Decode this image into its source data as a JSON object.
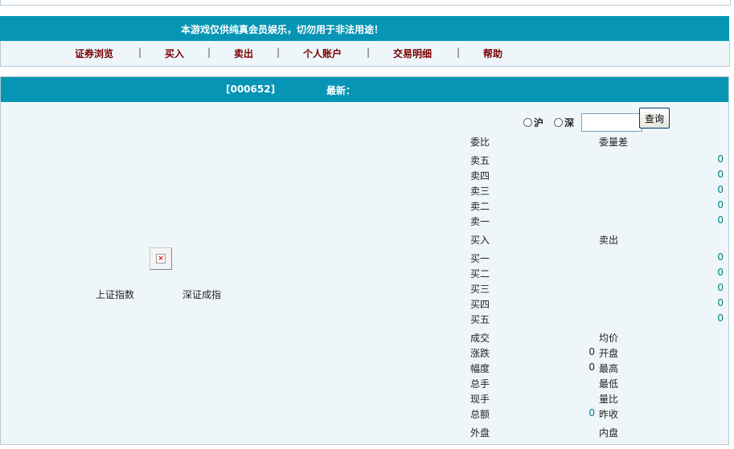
{
  "banner": {
    "notice": "本游戏仅供纯真会员娱乐，切勿用于非法用途！"
  },
  "nav": {
    "items": [
      "证券浏览",
      "买入",
      "卖出",
      "个人账户",
      "交易明细",
      "帮助"
    ],
    "separator": "|"
  },
  "header": {
    "code": "[000652]",
    "latest_label": "最新："
  },
  "indices": {
    "sh": "上证指数",
    "sz": "深证成指"
  },
  "exchange": {
    "sh": "沪",
    "sz": "深",
    "query_button": "查询",
    "search_value": ""
  },
  "order_book": {
    "ratio_label": "委比",
    "diff_label": "委量差",
    "sell_rows": [
      {
        "label": "卖五",
        "value": "0"
      },
      {
        "label": "卖四",
        "value": "0"
      },
      {
        "label": "卖三",
        "value": "0"
      },
      {
        "label": "卖二",
        "value": "0"
      },
      {
        "label": "卖一",
        "value": "0"
      }
    ],
    "buy_label": "买入",
    "sell_label": "卖出",
    "buy_rows": [
      {
        "label": "买一",
        "value": "0"
      },
      {
        "label": "买二",
        "value": "0"
      },
      {
        "label": "买三",
        "value": "0"
      },
      {
        "label": "买四",
        "value": "0"
      },
      {
        "label": "买五",
        "value": "0"
      }
    ]
  },
  "stats": {
    "deal": "成交",
    "avg_price": "均价",
    "change": "涨跌",
    "change_value": "0",
    "open": "开盘",
    "amplitude": "幅度",
    "amplitude_value": "0",
    "high": "最高",
    "total_volume": "总手",
    "low": "最低",
    "current_volume": "现手",
    "volume_ratio": "量比",
    "total_amount": "总额",
    "total_amount_value": "0",
    "prev_close": "昨收",
    "outer": "外盘",
    "inner": "内盘"
  }
}
